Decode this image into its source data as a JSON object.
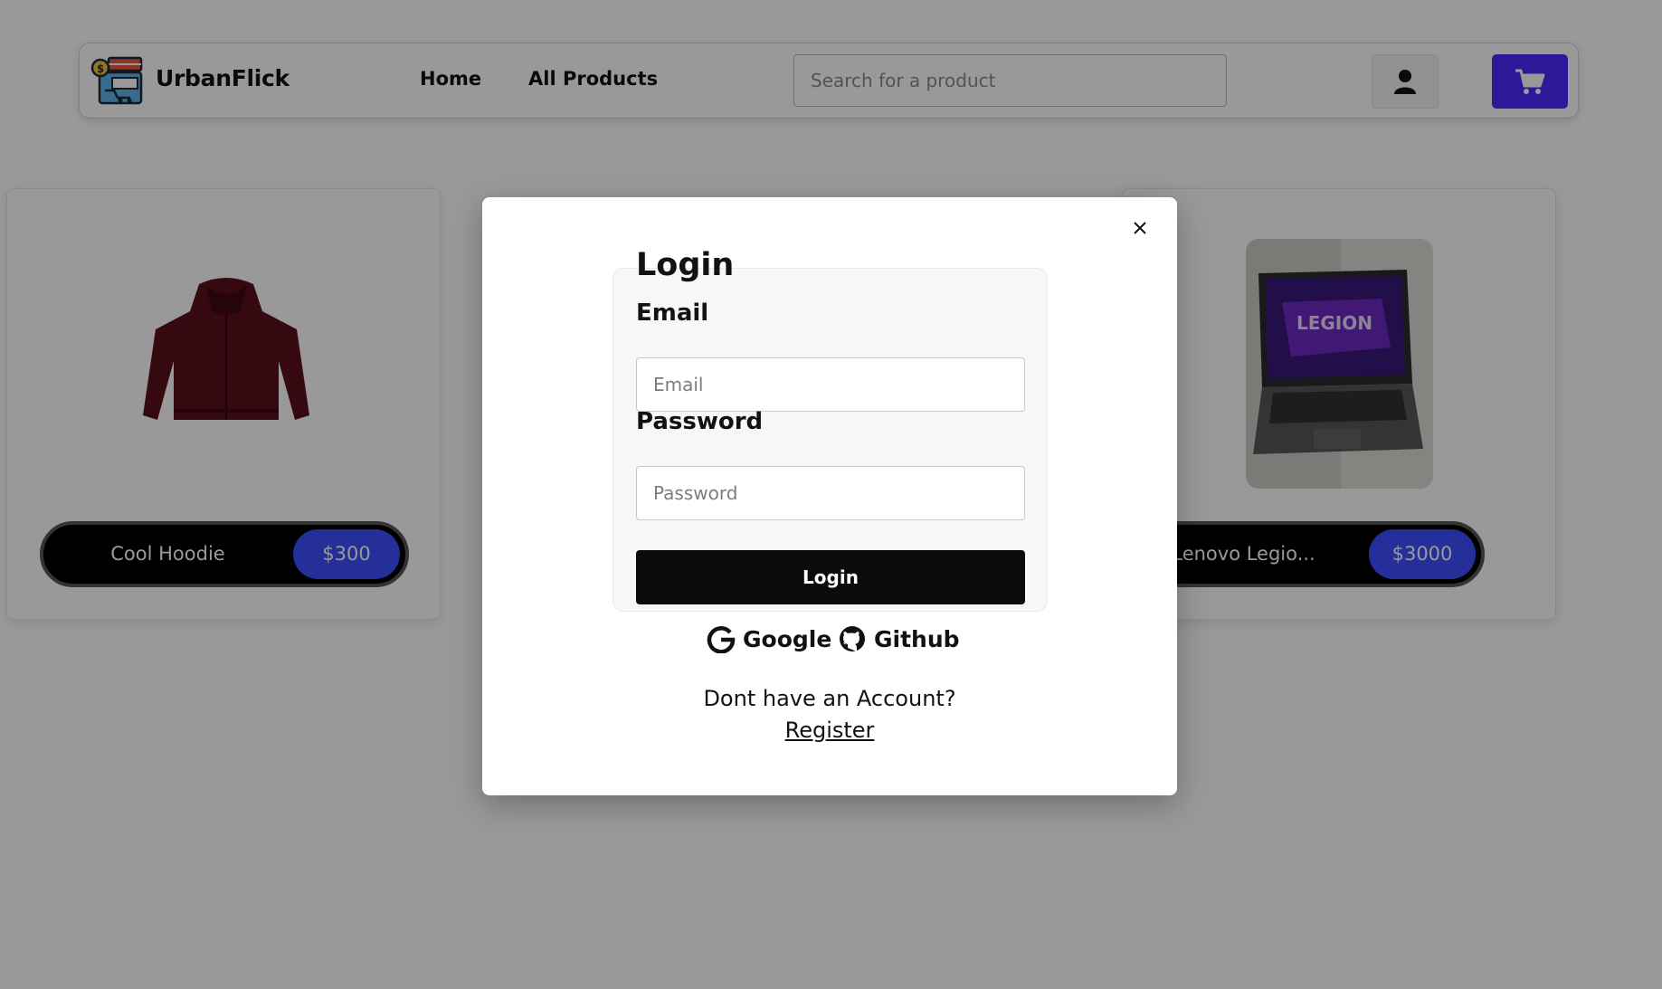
{
  "header": {
    "brand": "UrbanFlick",
    "nav": {
      "home": "Home",
      "all_products": "All Products"
    },
    "search": {
      "placeholder": "Search for a product",
      "value": ""
    },
    "icons": {
      "logo": "store-logo-icon",
      "user": "user-icon",
      "cart": "cart-icon"
    },
    "cart_button_color": "#4a2bff"
  },
  "products": [
    {
      "name": "Cool Hoodie",
      "price": "$300",
      "image": "maroon-hoodie-image"
    },
    {
      "name": "Lenovo Legio...",
      "price": "$3000",
      "image": "lenovo-legion-laptop-image",
      "screen_text": "LEGION"
    }
  ],
  "modal": {
    "title": "Login",
    "email": {
      "label": "Email",
      "placeholder": "Email",
      "value": ""
    },
    "password": {
      "label": "Password",
      "placeholder": "Password",
      "value": ""
    },
    "submit_label": "Login",
    "oauth": {
      "google": "Google",
      "github": "Github"
    },
    "no_account_text": "Dont have an Account?",
    "register_label": "Register",
    "close_icon": "close-icon"
  },
  "colors": {
    "price_badge": "#3c4fff",
    "overlay": "rgba(0,0,0,0.4)",
    "login_button": "#0b0b0b"
  }
}
